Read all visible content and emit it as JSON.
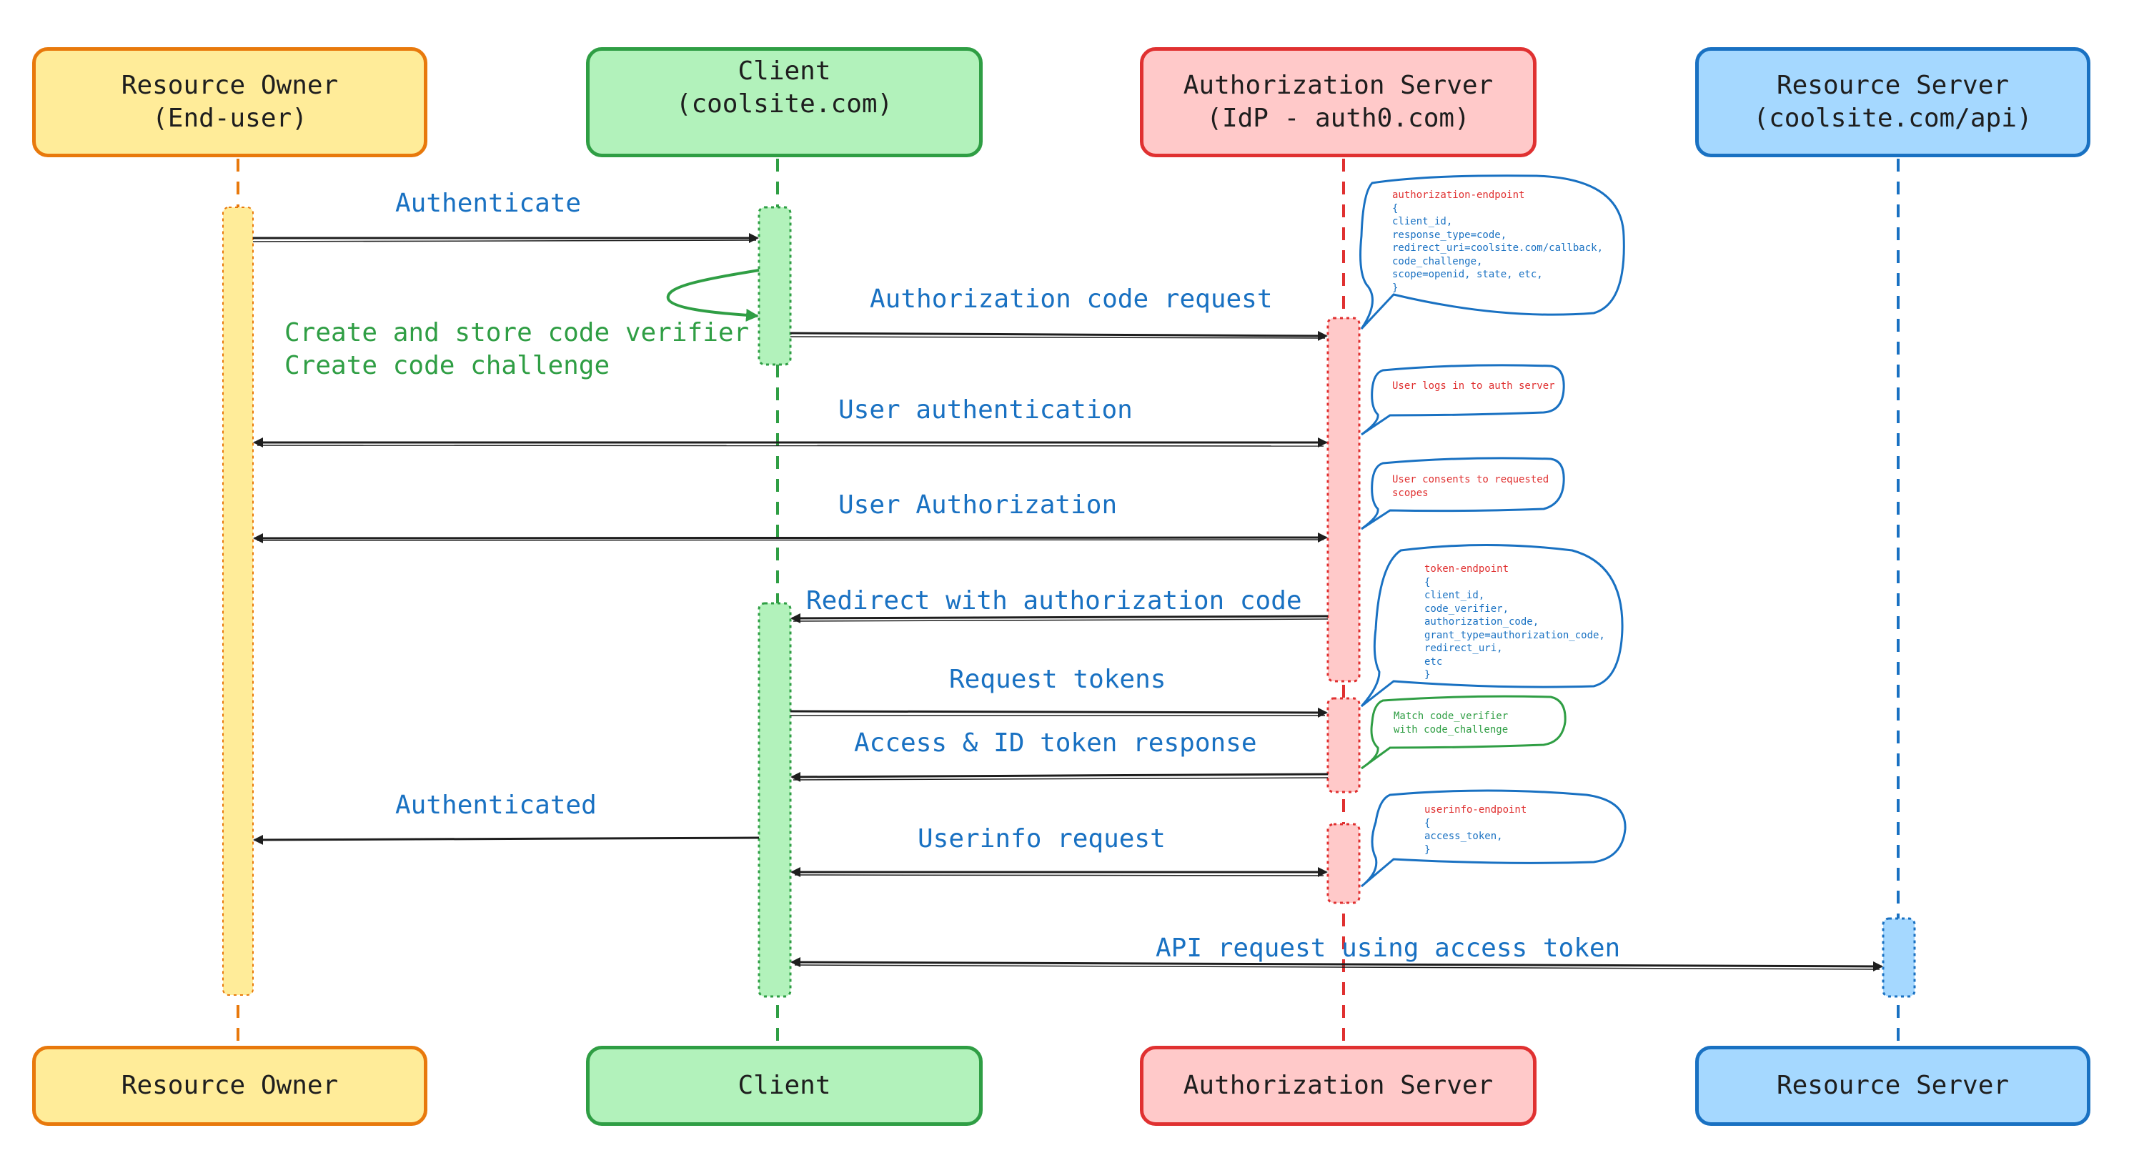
{
  "colors": {
    "owner_fill": "#ffec99",
    "owner_stroke": "#e8790c",
    "client_fill": "#b2f2bb",
    "client_stroke": "#2f9e44",
    "auth_fill": "#ffc9c9",
    "auth_stroke": "#e03131",
    "resource_fill": "#a5d8ff",
    "resource_stroke": "#1971c2",
    "message_text": "#1971c2",
    "arrow": "#1e1e1e"
  },
  "actors": {
    "owner": {
      "top_line1": "Resource Owner",
      "top_line2": "(End-user)",
      "bottom": "Resource Owner"
    },
    "client": {
      "top_line1": "Client",
      "top_line2": "(coolsite.com)",
      "bottom": "Client"
    },
    "auth": {
      "top_line1": "Authorization Server",
      "top_line2": "(IdP - auth0.com)",
      "bottom": "Authorization Server"
    },
    "resource": {
      "top_line1": "Resource Server",
      "top_line2": "(coolsite.com/api)",
      "bottom": "Resource Server"
    }
  },
  "messages": [
    {
      "label": "Authenticate",
      "from": "owner",
      "to": "client",
      "direction": "forward"
    },
    {
      "label": "Authorization code request",
      "from": "client",
      "to": "auth",
      "direction": "forward"
    },
    {
      "label": "User authentication",
      "from": "owner",
      "to": "auth",
      "direction": "both"
    },
    {
      "label": "User Authorization",
      "from": "owner",
      "to": "auth",
      "direction": "both"
    },
    {
      "label": "Redirect with authorization code",
      "from": "auth",
      "to": "client",
      "direction": "forward"
    },
    {
      "label": "Request tokens",
      "from": "client",
      "to": "auth",
      "direction": "forward"
    },
    {
      "label": "Access & ID token response",
      "from": "auth",
      "to": "client",
      "direction": "forward"
    },
    {
      "label": "Authenticated",
      "from": "client",
      "to": "owner",
      "direction": "forward"
    },
    {
      "label": "Userinfo request",
      "from": "client",
      "to": "auth",
      "direction": "both"
    },
    {
      "label": "API request using access token",
      "from": "client",
      "to": "resource",
      "direction": "forward"
    }
  ],
  "self_note": {
    "line1": "Create and store code verifier",
    "line2": "Create code challenge"
  },
  "bubbles": {
    "authorization_endpoint": {
      "header": "authorization-endpoint",
      "lines": [
        "{",
        "client_id,",
        "response_type=code,",
        "redirect_uri=coolsite.com/callback,",
        "code_challenge,",
        "scope=openid, state, etc,",
        "}"
      ]
    },
    "user_login": {
      "text": "User logs in to auth server"
    },
    "user_consent": {
      "line1": "User consents to requested",
      "line2": "scopes"
    },
    "token_endpoint": {
      "header": "token-endpoint",
      "lines": [
        "{",
        "client_id,",
        "code_verifier,",
        "authorization_code,",
        "grant_type=authorization_code,",
        "redirect_uri,",
        "etc",
        "}"
      ]
    },
    "match_verifier": {
      "line1": "Match code_verifier",
      "line2": "with code_challenge"
    },
    "userinfo_endpoint": {
      "header": "userinfo-endpoint",
      "lines": [
        "{",
        "access_token,",
        "}"
      ]
    }
  }
}
